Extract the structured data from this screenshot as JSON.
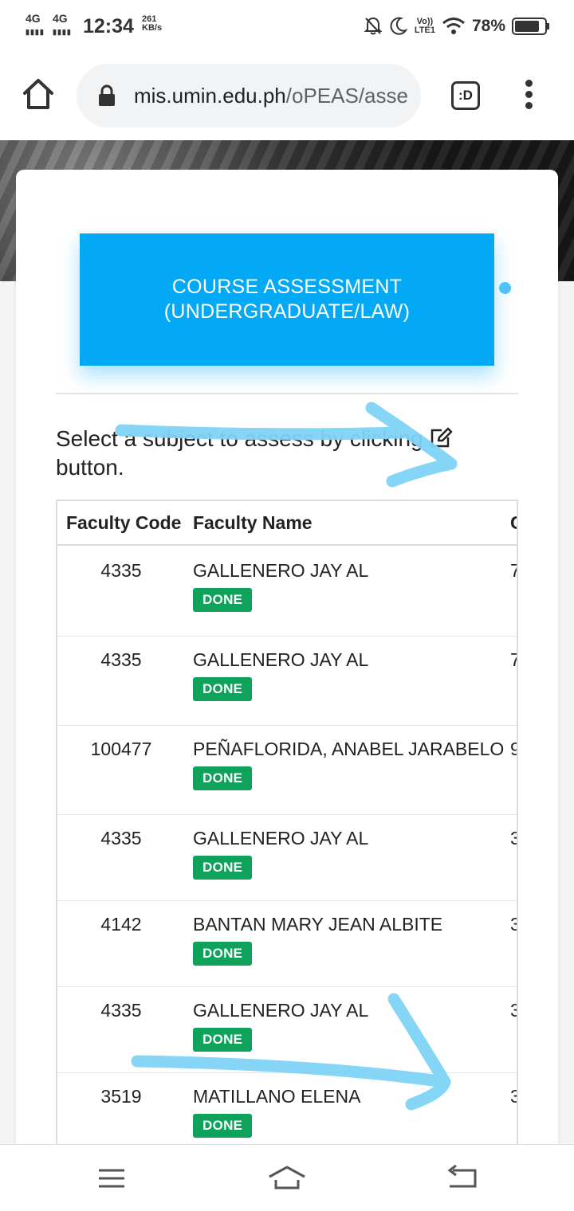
{
  "status_bar": {
    "network_1": "4G",
    "network_2": "4G",
    "time": "12:34",
    "speed_value": "261",
    "speed_unit": "KB/s",
    "volte": "Vo))",
    "lte": "LTE1",
    "battery": "78%"
  },
  "browser": {
    "url_host": "mis.umin.edu.ph",
    "url_path": "/oPEAS/asse",
    "tab_label": ":D"
  },
  "card": {
    "title_line1": "COURSE ASSESSMENT",
    "title_line2": "(UNDERGRADUATE/LAW)",
    "instruction_before": "Select a subject to assess by clicking",
    "instruction_after": "button."
  },
  "table": {
    "headers": {
      "code": "Faculty Code",
      "name": "Faculty Name",
      "cut": "C"
    },
    "rows": [
      {
        "code": "4335",
        "name": "GALLENERO JAY AL",
        "status": "DONE",
        "cut": "7"
      },
      {
        "code": "4335",
        "name": "GALLENERO JAY AL",
        "status": "DONE",
        "cut": "7"
      },
      {
        "code": "100477",
        "name": "PEÑAFLORIDA, ANABEL JARABELO",
        "status": "DONE",
        "cut": "9"
      },
      {
        "code": "4335",
        "name": "GALLENERO JAY AL",
        "status": "DONE",
        "cut": "3"
      },
      {
        "code": "4142",
        "name": "BANTAN MARY JEAN ALBITE",
        "status": "DONE",
        "cut": "3"
      },
      {
        "code": "4335",
        "name": "GALLENERO JAY AL",
        "status": "DONE",
        "cut": "3"
      },
      {
        "code": "3519",
        "name": "MATILLANO ELENA",
        "status": "DONE",
        "cut": "3"
      }
    ]
  },
  "colors": {
    "banner": "#03a9f4",
    "done_badge": "#0ea25a",
    "scribble": "#7fd3f7"
  }
}
